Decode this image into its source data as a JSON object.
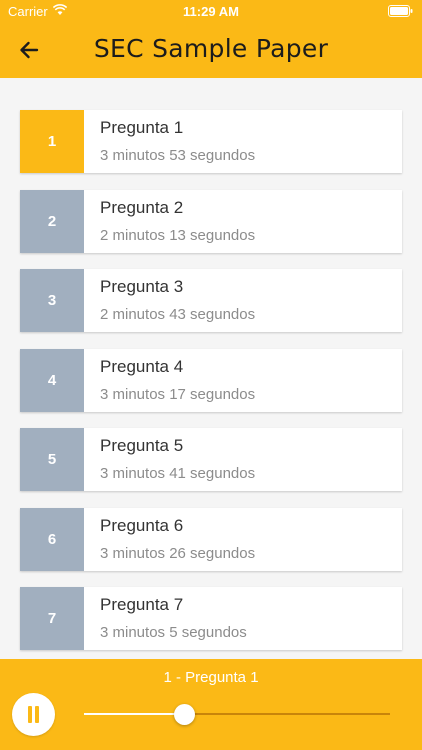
{
  "status_bar": {
    "carrier": "Carrier",
    "time": "11:29 AM"
  },
  "header": {
    "title": "SEC Sample Paper",
    "back_icon": "arrow-left-icon"
  },
  "questions": [
    {
      "number": "1",
      "title": "Pregunta 1",
      "duration": "3 minutos 53 segundos",
      "active": true
    },
    {
      "number": "2",
      "title": "Pregunta 2",
      "duration": "2 minutos 13 segundos",
      "active": false
    },
    {
      "number": "3",
      "title": "Pregunta 3",
      "duration": "2 minutos 43 segundos",
      "active": false
    },
    {
      "number": "4",
      "title": "Pregunta 4",
      "duration": "3 minutos 17 segundos",
      "active": false
    },
    {
      "number": "5",
      "title": "Pregunta 5",
      "duration": "3 minutos 41 segundos",
      "active": false
    },
    {
      "number": "6",
      "title": "Pregunta 6",
      "duration": "3 minutos 26 segundos",
      "active": false
    },
    {
      "number": "7",
      "title": "Pregunta 7",
      "duration": "3 minutos 5 segundos",
      "active": false
    }
  ],
  "player": {
    "now_playing": "1 - Pregunta 1",
    "progress": 0.33,
    "state": "playing"
  },
  "colors": {
    "accent": "#fbb916",
    "inactive_number": "#a1afbf"
  }
}
